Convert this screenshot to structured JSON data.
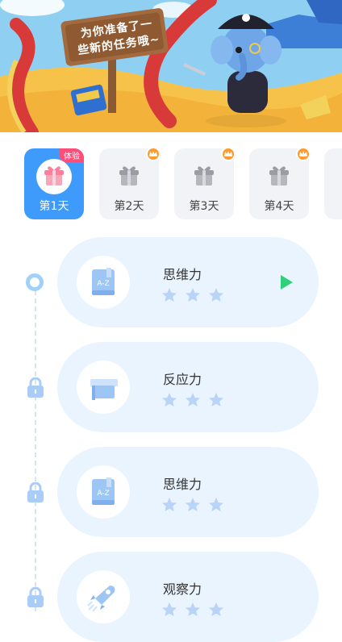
{
  "banner": {
    "sign_line1": "为你准备了一",
    "sign_line2": "些新的任务哦~"
  },
  "days": [
    {
      "label": "第1天",
      "badge": "体验",
      "active": true
    },
    {
      "label": "第2天",
      "crown": true
    },
    {
      "label": "第3天",
      "crown": true
    },
    {
      "label": "第4天",
      "crown": true
    }
  ],
  "tasks": [
    {
      "title": "思维力",
      "icon": "book-az-icon",
      "state": "current",
      "stars_total": 3,
      "stars_earned": 0
    },
    {
      "title": "反应力",
      "icon": "graduation-cap-icon",
      "state": "locked",
      "stars_total": 3,
      "stars_earned": 0
    },
    {
      "title": "思维力",
      "icon": "book-az-icon",
      "state": "locked",
      "stars_total": 3,
      "stars_earned": 0
    },
    {
      "title": "观察力",
      "icon": "rocket-icon",
      "state": "locked",
      "stars_total": 3,
      "stars_earned": 0
    }
  ],
  "colors": {
    "accent": "#3f9bfb",
    "card_bg": "#eaf4ff",
    "star": "#b9d4f7",
    "play": "#2fd07a",
    "badge": "#ff4d79",
    "crown": "#ff9a2e"
  }
}
